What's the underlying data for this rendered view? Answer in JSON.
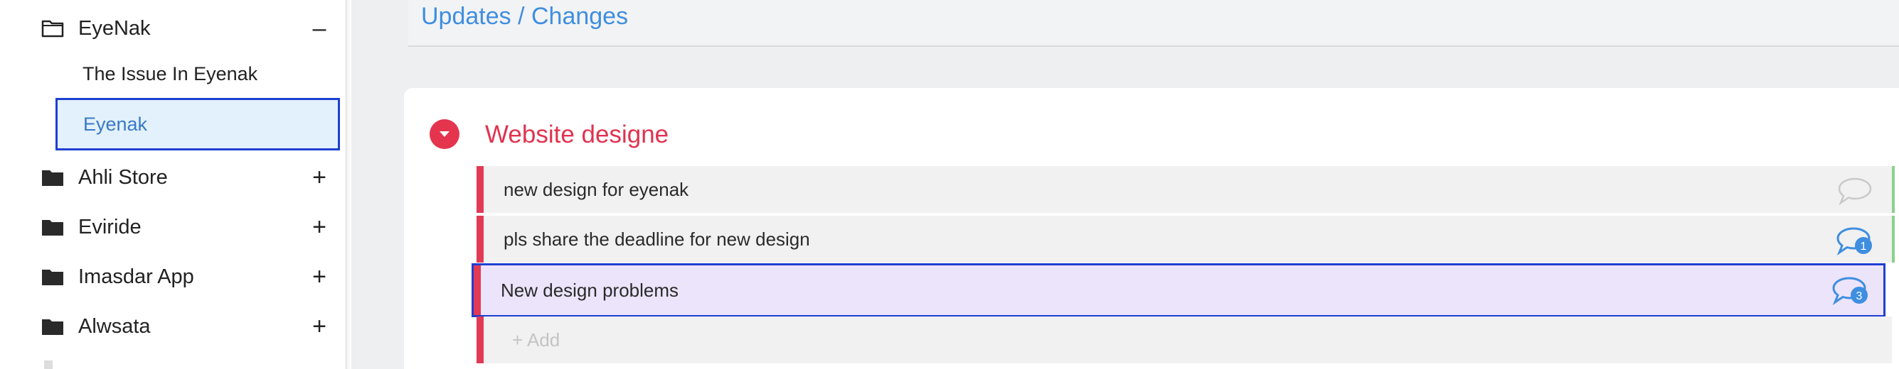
{
  "sidebar": {
    "projects": [
      {
        "name": "EyeNak",
        "toggle": "–",
        "expanded": true,
        "icon": "folder-outline-icon"
      },
      {
        "name": "Ahli Store",
        "toggle": "+",
        "icon": "folder-icon"
      },
      {
        "name": "Eviride",
        "toggle": "+",
        "icon": "folder-icon"
      },
      {
        "name": "Imasdar App",
        "toggle": "+",
        "icon": "folder-icon"
      },
      {
        "name": "Alwsata",
        "toggle": "+",
        "icon": "folder-icon"
      }
    ],
    "sub_items": [
      {
        "label": "The Issue In Eyenak"
      },
      {
        "label": "Eyenak",
        "selected": true
      }
    ]
  },
  "main": {
    "breadcrumb": "Updates / Changes",
    "group": {
      "title": "Website designe",
      "color": "#e0334f"
    },
    "rows": [
      {
        "label": "new design for eyenak",
        "comment_count": ""
      },
      {
        "label": "pls share the deadline for new design",
        "comment_count": "1"
      },
      {
        "label": "New design problems",
        "comment_count": "3"
      }
    ],
    "add_label": "+ Add"
  },
  "colors": {
    "accent_blue": "#3f8ee0",
    "selection_border": "#1f3fd0",
    "group_red": "#e13a55"
  }
}
